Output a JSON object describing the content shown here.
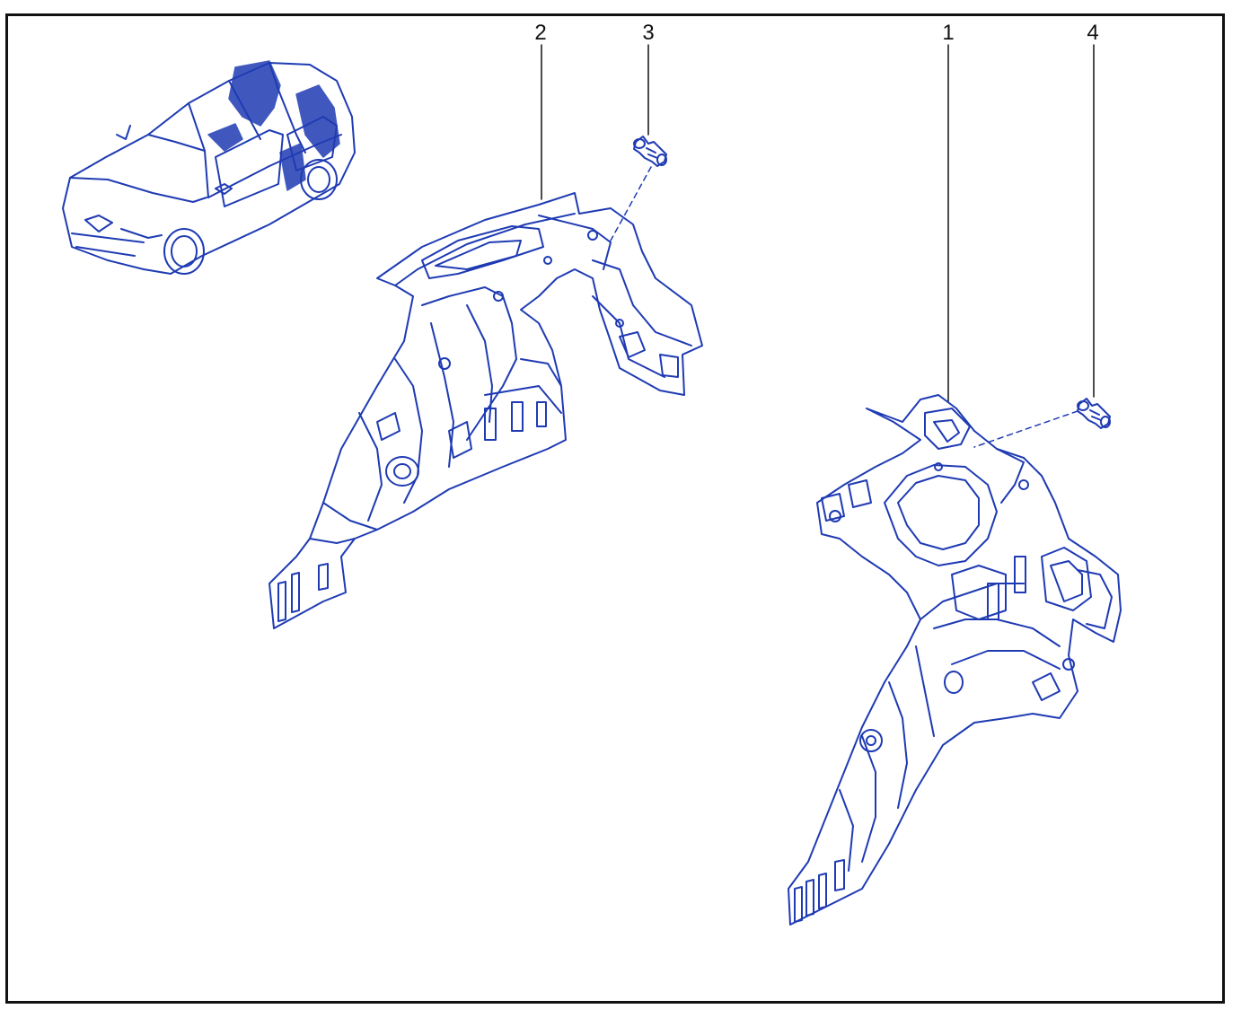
{
  "diagram": {
    "callouts": [
      {
        "id": "callout-2",
        "label": "2"
      },
      {
        "id": "callout-3",
        "label": "3"
      },
      {
        "id": "callout-1",
        "label": "1"
      },
      {
        "id": "callout-4",
        "label": "4"
      }
    ],
    "colors": {
      "line_art": "#1f3bb3",
      "line_art_light": "#5a6fd0",
      "frame": "#111111",
      "background": "#ffffff"
    },
    "icons": [
      "car-overview-icon",
      "rear-inner-panel-part",
      "push-clip-fastener-part"
    ]
  }
}
